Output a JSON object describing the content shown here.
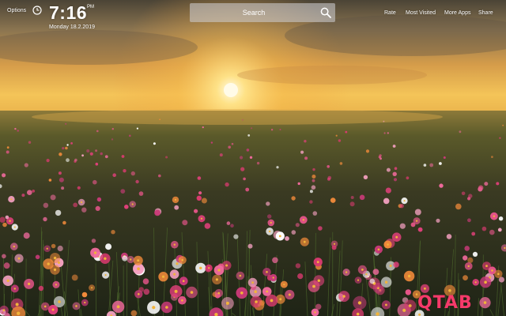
{
  "app": {
    "logo_text": "QTAB"
  },
  "topbar": {
    "options_label": "Options",
    "clock_icon": "clock-icon",
    "time": "7:16",
    "ampm": "PM",
    "date": "Monday  18.2.2019"
  },
  "search": {
    "placeholder": "Search",
    "value": "",
    "icon": "search-icon"
  },
  "nav": {
    "rate": "Rate",
    "most_visited": "Most Visited",
    "more_apps": "More Apps",
    "share": "Share"
  },
  "colors": {
    "logo": "#f53a6a",
    "text": "#ffffff",
    "sun": "#fff6c8"
  }
}
